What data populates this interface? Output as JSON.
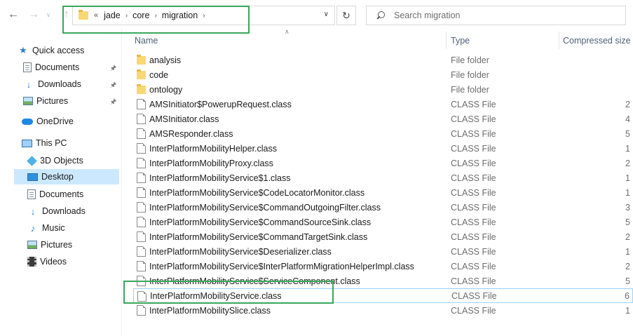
{
  "nav": {
    "back_icon": "arrow-left-icon",
    "forward_icon": "arrow-right-icon",
    "recent_icon": "chevron-down-icon",
    "up_icon": "arrow-up-icon"
  },
  "address": {
    "overflow": "«",
    "crumbs": [
      "jade",
      "core",
      "migration"
    ]
  },
  "search": {
    "placeholder": "Search migration"
  },
  "sidebar": {
    "items": [
      {
        "label": "Quick access",
        "icon": "star-icon"
      },
      {
        "label": "Documents",
        "icon": "documents-icon",
        "pinned": true
      },
      {
        "label": "Downloads",
        "icon": "downloads-icon",
        "pinned": true
      },
      {
        "label": "Pictures",
        "icon": "pictures-icon",
        "pinned": true
      },
      {
        "label": "OneDrive",
        "icon": "cloud-icon"
      },
      {
        "label": "This PC",
        "icon": "computer-icon"
      },
      {
        "label": "3D Objects",
        "icon": "cube-icon"
      },
      {
        "label": "Desktop",
        "icon": "desktop-icon",
        "selected": true
      },
      {
        "label": "Documents",
        "icon": "documents-icon"
      },
      {
        "label": "Downloads",
        "icon": "downloads-icon"
      },
      {
        "label": "Music",
        "icon": "music-icon"
      },
      {
        "label": "Pictures",
        "icon": "pictures-icon"
      },
      {
        "label": "Videos",
        "icon": "videos-icon"
      }
    ]
  },
  "columns": {
    "name": "Name",
    "type": "Type",
    "size": "Compressed size"
  },
  "files": [
    {
      "name": "analysis",
      "type": "File folder",
      "size": "",
      "kind": "folder"
    },
    {
      "name": "code",
      "type": "File folder",
      "size": "",
      "kind": "folder"
    },
    {
      "name": "ontology",
      "type": "File folder",
      "size": "",
      "kind": "folder"
    },
    {
      "name": "AMSInitiator$PowerupRequest.class",
      "type": "CLASS File",
      "size": "2",
      "kind": "file"
    },
    {
      "name": "AMSInitiator.class",
      "type": "CLASS File",
      "size": "4",
      "kind": "file"
    },
    {
      "name": "AMSResponder.class",
      "type": "CLASS File",
      "size": "5",
      "kind": "file"
    },
    {
      "name": "InterPlatformMobilityHelper.class",
      "type": "CLASS File",
      "size": "1",
      "kind": "file"
    },
    {
      "name": "InterPlatformMobilityProxy.class",
      "type": "CLASS File",
      "size": "2",
      "kind": "file"
    },
    {
      "name": "InterPlatformMobilityService$1.class",
      "type": "CLASS File",
      "size": "1",
      "kind": "file"
    },
    {
      "name": "InterPlatformMobilityService$CodeLocatorMonitor.class",
      "type": "CLASS File",
      "size": "1",
      "kind": "file"
    },
    {
      "name": "InterPlatformMobilityService$CommandOutgoingFilter.class",
      "type": "CLASS File",
      "size": "3",
      "kind": "file"
    },
    {
      "name": "InterPlatformMobilityService$CommandSourceSink.class",
      "type": "CLASS File",
      "size": "5",
      "kind": "file"
    },
    {
      "name": "InterPlatformMobilityService$CommandTargetSink.class",
      "type": "CLASS File",
      "size": "2",
      "kind": "file"
    },
    {
      "name": "InterPlatformMobilityService$Deserializer.class",
      "type": "CLASS File",
      "size": "1",
      "kind": "file"
    },
    {
      "name": "InterPlatformMobilityService$InterPlatformMigrationHelperImpl.class",
      "type": "CLASS File",
      "size": "2",
      "kind": "file"
    },
    {
      "name": "InterPlatformMobilityService$ServiceComponent.class",
      "type": "CLASS File",
      "size": "5",
      "kind": "file"
    },
    {
      "name": "InterPlatformMobilityService.class",
      "type": "CLASS File",
      "size": "6",
      "kind": "file",
      "highlighted": true
    },
    {
      "name": "InterPlatformMobilitySlice.class",
      "type": "CLASS File",
      "size": "1",
      "kind": "file"
    }
  ],
  "colors": {
    "annotation": "#3aa65a",
    "selection": "#cce8ff",
    "hover_outline": "#99d1ff"
  }
}
